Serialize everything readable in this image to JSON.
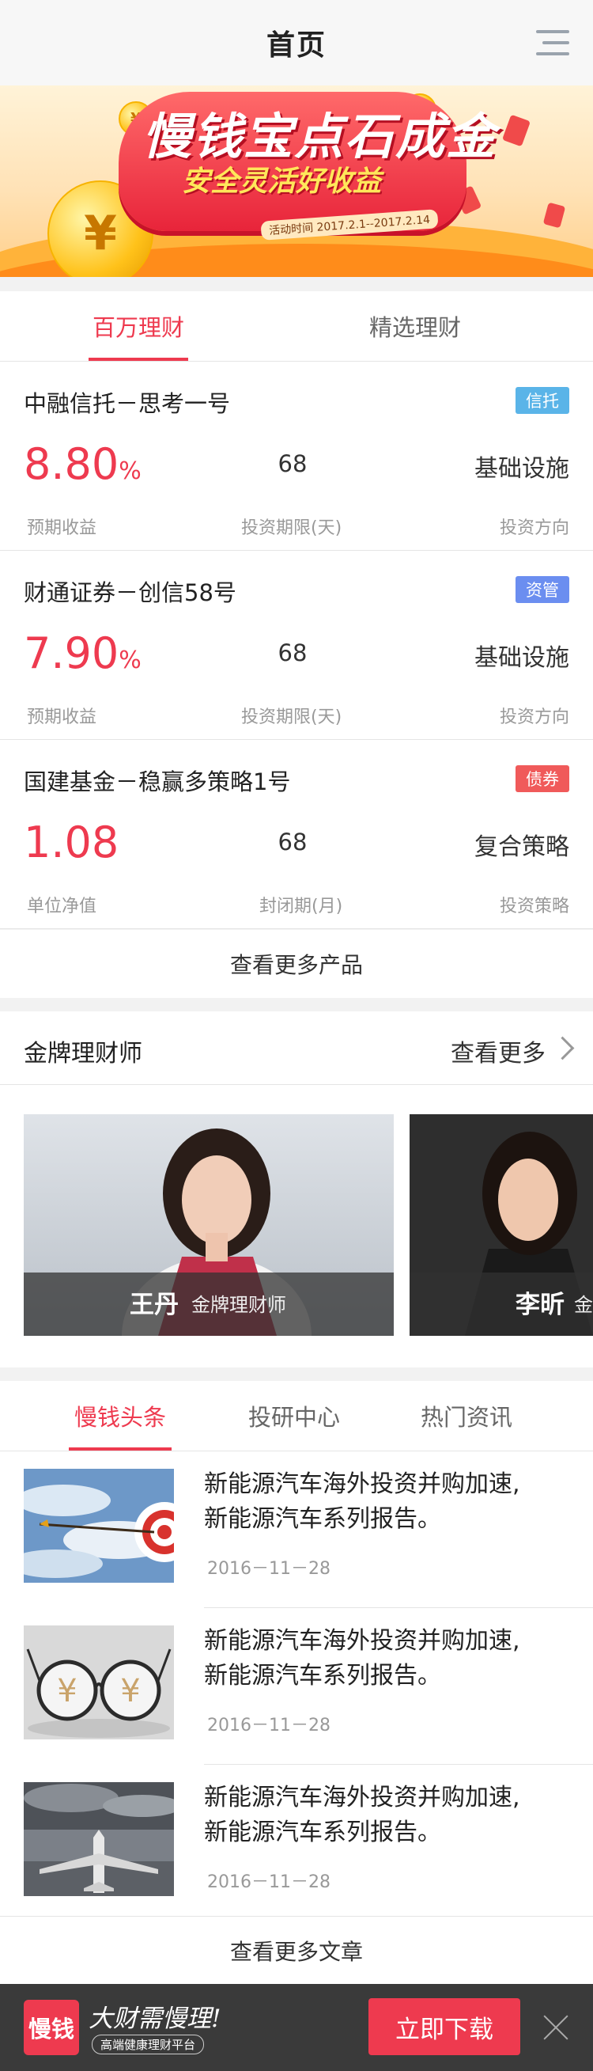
{
  "header": {
    "title": "首页",
    "menu_icon": "menu-icon"
  },
  "banner": {
    "title": "慢钱宝点石成金",
    "subtitle": "安全灵活好收益",
    "date": "活动时间 2017.2.1--2017.2.14",
    "coin_symbol": "¥"
  },
  "product_tabs": [
    {
      "label": "百万理财",
      "active": true
    },
    {
      "label": "精选理财",
      "active": false
    }
  ],
  "products": [
    {
      "name": "中融信托－思考一号",
      "tag": "信托",
      "tag_color": "#5ab4e8",
      "rate": "8.80",
      "rate_unit": "%",
      "rate_label": "预期收益",
      "term": "68",
      "term_label": "投资期限(天)",
      "direction": "基础设施",
      "direction_label": "投资方向"
    },
    {
      "name": "财通证券－创信58号",
      "tag": "资管",
      "tag_color": "#6b8ef0",
      "rate": "7.90",
      "rate_unit": "%",
      "rate_label": "预期收益",
      "term": "68",
      "term_label": "投资期限(天)",
      "direction": "基础设施",
      "direction_label": "投资方向"
    },
    {
      "name": "国建基金－稳赢多策略1号",
      "tag": "债券",
      "tag_color": "#f05a5a",
      "rate": "1.08",
      "rate_unit": "",
      "rate_label": "单位净值",
      "term": "68",
      "term_label": "封闭期(月)",
      "direction": "复合策略",
      "direction_label": "投资策略"
    }
  ],
  "more_products": "查看更多产品",
  "advisors": {
    "title": "金牌理财师",
    "more": "查看更多",
    "items": [
      {
        "name": "王丹",
        "role": "金牌理财师"
      },
      {
        "name": "李昕",
        "role": "金"
      }
    ]
  },
  "news_tabs": [
    {
      "label": "慢钱头条",
      "active": true
    },
    {
      "label": "投研中心",
      "active": false
    },
    {
      "label": "热门资讯",
      "active": false
    }
  ],
  "news": [
    {
      "line1": "新能源汽车海外投资并购加速,",
      "line2": "新能源汽车系列报告。",
      "date": "2016－11－28",
      "image": "dart-target"
    },
    {
      "line1": "新能源汽车海外投资并购加速,",
      "line2": "新能源汽车系列报告。",
      "date": "2016－11－28",
      "image": "yuan-glasses"
    },
    {
      "line1": "新能源汽车海外投资并购加速,",
      "line2": "新能源汽车系列报告。",
      "date": "2016－11－28",
      "image": "airplane"
    }
  ],
  "more_articles": "查看更多文章",
  "bottom_bar": {
    "logo": "慢钱",
    "slogan": "大财需慢理!",
    "slogan_sub": "高端健康理财平台",
    "download": "立即下载"
  }
}
